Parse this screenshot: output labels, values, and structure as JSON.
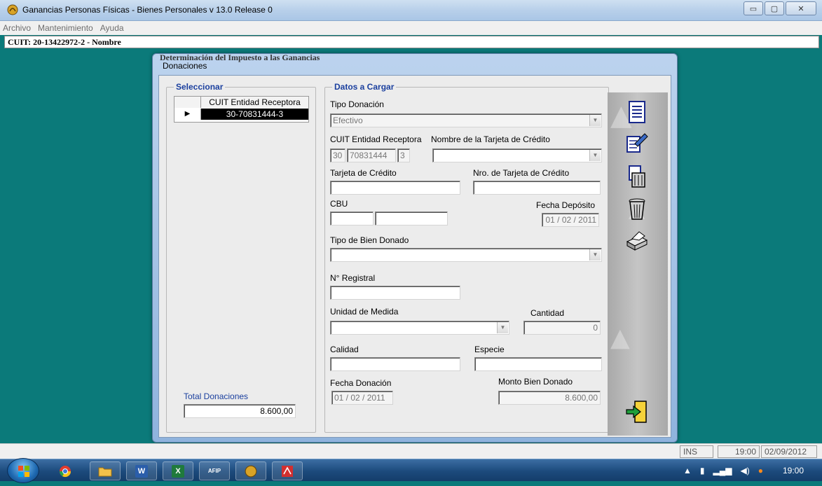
{
  "window": {
    "title": "Ganancias Personas Físicas - Bienes Personales v 13.0 Release 0",
    "minimize": "▭",
    "maximize": "▢",
    "close": "✕"
  },
  "menu": [
    "Archivo",
    "Mantenimiento",
    "Ayuda"
  ],
  "cuit_header": "CUIT: 20-13422972-2 - Nombre",
  "behind_dialog_text": "Determinación del Impuesto a las Ganancias",
  "dialog": {
    "title": "Donaciones",
    "seleccionar": {
      "legend": "Seleccionar",
      "column_header": "CUIT Entidad Receptora",
      "row_marker": "▶",
      "rows": [
        "30-70831444-3"
      ]
    },
    "total": {
      "label": "Total Donaciones",
      "value": "8.600,00"
    },
    "datos": {
      "legend": "Datos a Cargar",
      "tipo_donacion": {
        "label": "Tipo Donación",
        "value": "Efectivo"
      },
      "cuit_entidad": {
        "label": "CUIT Entidad Receptora",
        "prefix": "30",
        "number": "70831444",
        "check": "3"
      },
      "nombre_tarjeta": {
        "label": "Nombre de la Tarjeta de Crédito",
        "value": ""
      },
      "tarjeta_credito": {
        "label": "Tarjeta de Crédito",
        "value": ""
      },
      "nro_tarjeta": {
        "label": "Nro. de Tarjeta de Crédito",
        "value": ""
      },
      "cbu": {
        "label": "CBU",
        "part1": "",
        "part2": ""
      },
      "fecha_deposito": {
        "label": "Fecha Depósito",
        "value": "01 / 02 / 2011"
      },
      "tipo_bien": {
        "label": "Tipo de Bien Donado",
        "value": ""
      },
      "nro_registral": {
        "label": "N° Registral",
        "value": ""
      },
      "unidad_medida": {
        "label": "Unidad de Medida",
        "value": ""
      },
      "cantidad": {
        "label": "Cantidad",
        "value": "0"
      },
      "calidad": {
        "label": "Calidad",
        "value": ""
      },
      "especie": {
        "label": "Especie",
        "value": ""
      },
      "fecha_donacion": {
        "label": "Fecha Donación",
        "value": "01 / 02 / 2011"
      },
      "monto_bien": {
        "label": "Monto Bien Donado",
        "value": "8.600,00"
      }
    },
    "dropdown_arrow": "▼"
  },
  "status": {
    "mode": "INS",
    "time": "19:00",
    "date": "02/09/2012"
  },
  "taskbar": {
    "apps": [
      "W",
      "X",
      "AFIP",
      "",
      ""
    ],
    "clock": "19:00"
  },
  "colors": {
    "desktop": "#0b7a7a",
    "legend_blue": "#1a3f9e"
  }
}
